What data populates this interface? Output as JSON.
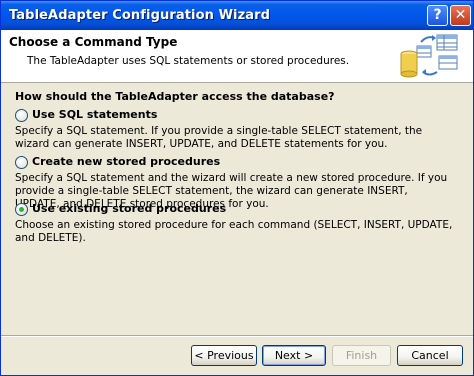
{
  "window": {
    "title": "TableAdapter Configuration Wizard",
    "help_glyph": "?",
    "close_glyph": "✕"
  },
  "header": {
    "title": "Choose a Command Type",
    "subtitle": "The TableAdapter uses SQL statements or stored procedures.",
    "icon": "database-table-sync-icon"
  },
  "question": "How should the TableAdapter access the database?",
  "options": [
    {
      "label": "Use SQL statements",
      "description": "Specify a SQL statement. If you provide a single-table SELECT statement, the wizard can generate INSERT, UPDATE, and DELETE statements for you.",
      "selected": false
    },
    {
      "label": "Create new stored procedures",
      "description": "Specify a SQL statement and the wizard will create a new stored procedure. If you provide a single-table SELECT statement, the wizard can generate INSERT, UPDATE, and DELETE stored procedures for you.",
      "selected": false
    },
    {
      "label": "Use existing stored procedures",
      "description": "Choose an existing stored procedure for each command (SELECT, INSERT, UPDATE, and DELETE).",
      "selected": true
    }
  ],
  "buttons": {
    "previous": "< Previous",
    "next": "Next >",
    "finish": "Finish",
    "cancel": "Cancel"
  },
  "colors": {
    "titlebar": "#0058ee",
    "dialog_bg": "#ece9d8",
    "selected_radio": "#2fb62c"
  }
}
